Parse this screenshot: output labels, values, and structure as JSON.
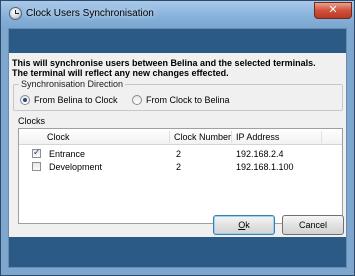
{
  "window": {
    "title": "Clock Users Synchronisation",
    "close_glyph": "✕"
  },
  "intro": {
    "line1": "This will synchronise users between Belina and the selected terminals.",
    "line2": "The terminal will reflect any new changes effected."
  },
  "direction": {
    "group_label": "Synchronisation Direction",
    "options": [
      {
        "label": "From Belina to Clock",
        "selected": true
      },
      {
        "label": "From Clock to Belina",
        "selected": false
      }
    ]
  },
  "clocks": {
    "label": "Clocks",
    "columns": [
      "Clock",
      "Clock Number",
      "IP Address"
    ],
    "rows": [
      {
        "checked": true,
        "clock": "Entrance",
        "number": "2",
        "ip": "192.168.2.4"
      },
      {
        "checked": false,
        "clock": "Development",
        "number": "2",
        "ip": "192.168.1.100"
      }
    ]
  },
  "buttons": {
    "ok_mnemonic": "O",
    "ok_rest": "k",
    "cancel": "Cancel"
  },
  "colors": {
    "banner": "#2b5a86",
    "titlebar": "#86b0d9"
  },
  "icons": {
    "app": "clock-icon",
    "close": "close-icon",
    "check": "checkmark-icon"
  }
}
